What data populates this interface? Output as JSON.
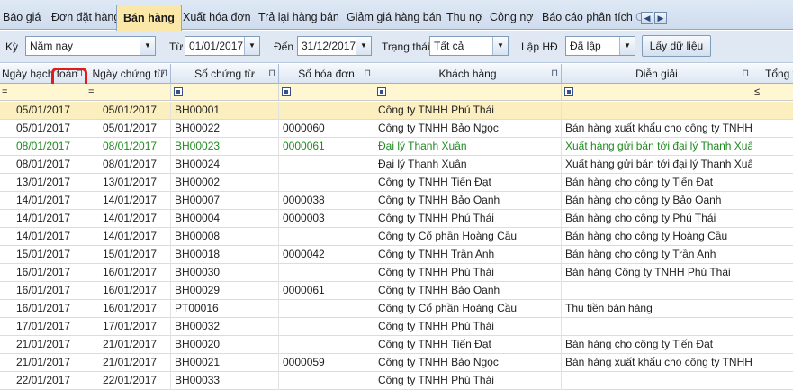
{
  "tabs": [
    "Báo giá",
    "Đơn đặt hàng",
    "Bán hàng",
    "Xuất hóa đơn",
    "Trả lại hàng bán",
    "Giảm giá hàng bán",
    "Thu nợ",
    "Công nợ",
    "Báo cáo phân tích",
    "C"
  ],
  "active_tab": "Bán hàng",
  "tab_scroll": {
    "left_icon": "chevron-left-icon",
    "right_icon": "chevron-right-icon",
    "left_glyph": "◀",
    "right_glyph": "▶"
  },
  "filters": {
    "period_label": "Kỳ",
    "period_value": "Năm nay",
    "from_label": "Từ",
    "from_value": "01/01/2017",
    "to_label": "Đến",
    "to_value": "31/12/2017",
    "status_label": "Trạng thái",
    "status_value": "Tất cả",
    "invoice_label": "Lập HĐ",
    "invoice_value": "Đã lập",
    "fetch_button": "Lấy dữ liệu"
  },
  "grid": {
    "columns": [
      "Ngày hạch toán",
      "Ngày chứng từ",
      "Số chứng từ",
      "Số hóa đơn",
      "Khách hàng",
      "Diễn giải",
      "Tổng tiề"
    ],
    "filter_ops": {
      "date1": "=",
      "date2": "=",
      "total": "≤"
    },
    "rows": [
      {
        "d1": "05/01/2017",
        "d2": "05/01/2017",
        "voucher": "BH00001",
        "invoice": "",
        "customer": "Công ty TNHH Phú Thái",
        "desc": ""
      },
      {
        "d1": "05/01/2017",
        "d2": "05/01/2017",
        "voucher": "BH00022",
        "invoice": "0000060",
        "customer": "Công ty TNHH Bảo Ngọc",
        "desc": "Bán hàng xuất khẩu cho công ty TNHH"
      },
      {
        "d1": "08/01/2017",
        "d2": "08/01/2017",
        "voucher": "BH00023",
        "invoice": "0000061",
        "customer": "Đại lý Thanh Xuân",
        "desc": "Xuất hàng gửi bán tới đại lý Thanh Xuân"
      },
      {
        "d1": "08/01/2017",
        "d2": "08/01/2017",
        "voucher": "BH00024",
        "invoice": "",
        "customer": "Đại lý Thanh Xuân",
        "desc": "Xuất hàng gửi bán tới đại lý Thanh Xuân"
      },
      {
        "d1": "13/01/2017",
        "d2": "13/01/2017",
        "voucher": "BH00002",
        "invoice": "",
        "customer": "Công ty TNHH Tiến Đạt",
        "desc": "Bán hàng cho công ty Tiến Đạt"
      },
      {
        "d1": "14/01/2017",
        "d2": "14/01/2017",
        "voucher": "BH00007",
        "invoice": "0000038",
        "customer": "Công ty TNHH Bảo Oanh",
        "desc": "Bán hàng cho công ty Bảo Oanh"
      },
      {
        "d1": "14/01/2017",
        "d2": "14/01/2017",
        "voucher": "BH00004",
        "invoice": "0000003",
        "customer": "Công ty TNHH Phú Thái",
        "desc": "Bán hàng cho công ty Phú Thái"
      },
      {
        "d1": "14/01/2017",
        "d2": "14/01/2017",
        "voucher": "BH00008",
        "invoice": "",
        "customer": "Công ty Cổ phần Hoàng Cầu",
        "desc": "Bán hàng cho công ty Hoàng Cầu"
      },
      {
        "d1": "15/01/2017",
        "d2": "15/01/2017",
        "voucher": "BH00018",
        "invoice": "0000042",
        "customer": "Công ty TNHH Trần Anh",
        "desc": "Bán hàng cho công ty Trần Anh"
      },
      {
        "d1": "16/01/2017",
        "d2": "16/01/2017",
        "voucher": "BH00030",
        "invoice": "",
        "customer": "Công ty TNHH Phú Thái",
        "desc": "Bán hàng Công ty TNHH Phú Thái"
      },
      {
        "d1": "16/01/2017",
        "d2": "16/01/2017",
        "voucher": "BH00029",
        "invoice": "0000061",
        "customer": "Công ty TNHH Bảo Oanh",
        "desc": ""
      },
      {
        "d1": "16/01/2017",
        "d2": "16/01/2017",
        "voucher": "PT00016",
        "invoice": "",
        "customer": "Công ty Cổ phần Hoàng Cầu",
        "desc": "Thu tiền bán hàng"
      },
      {
        "d1": "17/01/2017",
        "d2": "17/01/2017",
        "voucher": "BH00032",
        "invoice": "",
        "customer": "Công ty TNHH Phú Thái",
        "desc": ""
      },
      {
        "d1": "21/01/2017",
        "d2": "21/01/2017",
        "voucher": "BH00020",
        "invoice": "",
        "customer": "Công ty TNHH Tiến Đạt",
        "desc": "Bán hàng cho công ty Tiến Đạt"
      },
      {
        "d1": "21/01/2017",
        "d2": "21/01/2017",
        "voucher": "BH00021",
        "invoice": "0000059",
        "customer": "Công ty TNHH Bảo Ngọc",
        "desc": "Bán hàng xuất khẩu cho công ty TNHH"
      },
      {
        "d1": "22/01/2017",
        "d2": "22/01/2017",
        "voucher": "BH00033",
        "invoice": "",
        "customer": "Công ty TNHH Phú Thái",
        "desc": ""
      }
    ]
  },
  "colors": {
    "green_row_text": "#1f8a1f",
    "selected_row": "#fbefbf",
    "filter_row": "#fff6d2",
    "active_tab": "#fbe7a7",
    "highlight_ring": "#e21b1b"
  },
  "icons": {
    "pin": "pin-icon",
    "sort": "sort-ascending-icon",
    "dropdown": "chevron-down-icon",
    "filter": "filter-marker-icon"
  }
}
